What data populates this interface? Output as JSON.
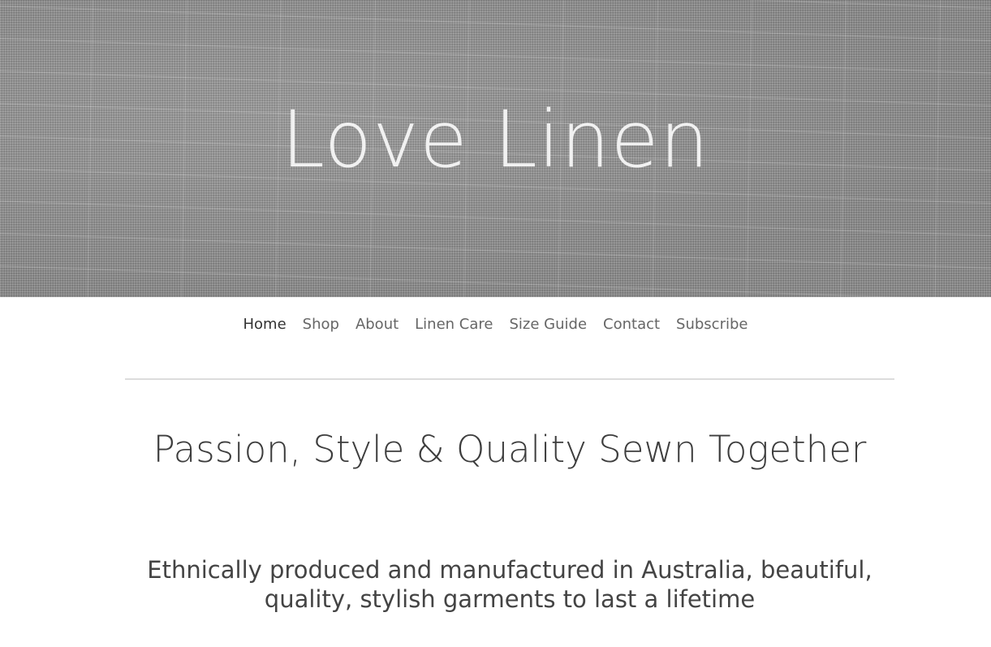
{
  "hero": {
    "title": "Love Linen"
  },
  "nav": {
    "items": [
      {
        "label": "Home",
        "active": true
      },
      {
        "label": "Shop"
      },
      {
        "label": "About"
      },
      {
        "label": "Linen Care"
      },
      {
        "label": "Size Guide"
      },
      {
        "label": "Contact"
      },
      {
        "label": "Subscribe"
      }
    ]
  },
  "main": {
    "headline": "Passion, Style & Quality Sewn Together",
    "tagline": "Ethnically produced and manufactured in Australia, beautiful, quality, stylish garments to last a lifetime"
  },
  "colors": {
    "hero_text": "#f1f1f1",
    "nav_text": "#666666",
    "nav_active": "#333333",
    "body_text": "#3d3d3d",
    "divider": "#dcdcdc"
  }
}
